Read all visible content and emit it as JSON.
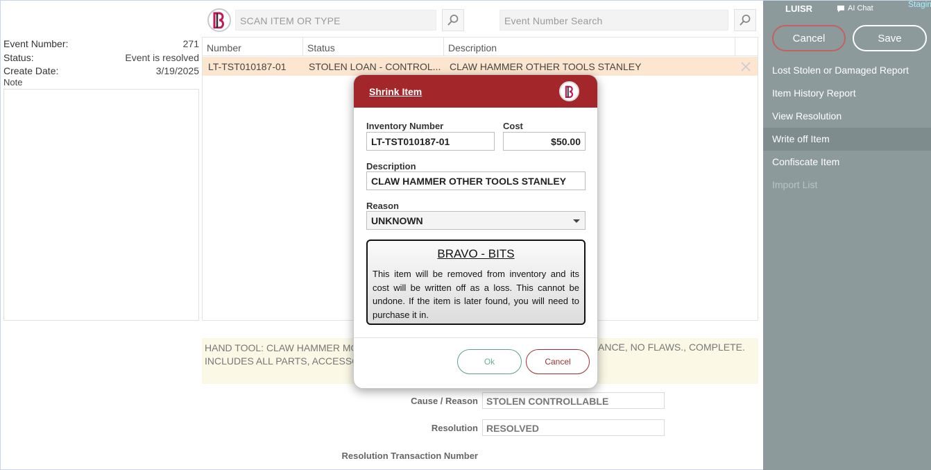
{
  "search": {
    "scan_placeholder": "SCAN ITEM OR TYPE",
    "event_placeholder": "Event Number Search"
  },
  "event": {
    "number_label": "Event Number:",
    "number_value": "271",
    "status_label": "Status:",
    "status_value": "Event is resolved",
    "create_label": "Create Date:",
    "create_value": "3/19/2025",
    "note_label": "Note"
  },
  "table": {
    "headers": [
      "Number",
      "Status",
      "Description"
    ],
    "rows": [
      {
        "number": "LT-TST010187-01",
        "status": "STOLEN LOAN - CONTROL...",
        "description": "CLAW HAMMER OTHER TOOLS STANLEY"
      }
    ]
  },
  "long_description": {
    "left_line1": "HAND TOOL: CLAW HAMMER MO",
    "left_line2": "INCLUDES ALL PARTS, ACCESSORI",
    "right_line1": "ANCE, NO FLAWS., COMPLETE."
  },
  "details": {
    "cause_label": "Cause / Reason",
    "cause_value": "STOLEN CONTROLLABLE",
    "resolution_label": "Resolution",
    "resolution_value": "RESOLVED",
    "txn_label": "Resolution Transaction Number"
  },
  "sidebar": {
    "user": "LUISR",
    "ai_chat": "AI Chat",
    "staging": "Stagin",
    "cancel": "Cancel",
    "save": "Save",
    "menu": [
      {
        "label": "Lost Stolen or Damaged Report"
      },
      {
        "label": "Item History Report"
      },
      {
        "label": "View Resolution"
      },
      {
        "label": "Write off Item"
      },
      {
        "label": "Confiscate Item"
      },
      {
        "label": "Import List"
      }
    ]
  },
  "modal": {
    "title": "Shrink Item",
    "inventory_label": "Inventory Number",
    "inventory_value": "LT-TST010187-01",
    "cost_label": "Cost",
    "cost_value": "$50.00",
    "description_label": "Description",
    "description_value": "CLAW HAMMER OTHER TOOLS STANLEY",
    "reason_label": "Reason",
    "reason_value": "UNKNOWN",
    "bits_title": "BRAVO - BITS",
    "bits_text": "This item will be removed from inventory and its cost will be written off as a loss.  This cannot be undone.  If the item is later found, you will need to purchase it in.",
    "ok": "Ok",
    "cancel": "Cancel"
  },
  "colors": {
    "accent_red": "#a3262b",
    "sidebar_bg": "#8d9a9c",
    "row_highlight": "#fde6cf"
  }
}
